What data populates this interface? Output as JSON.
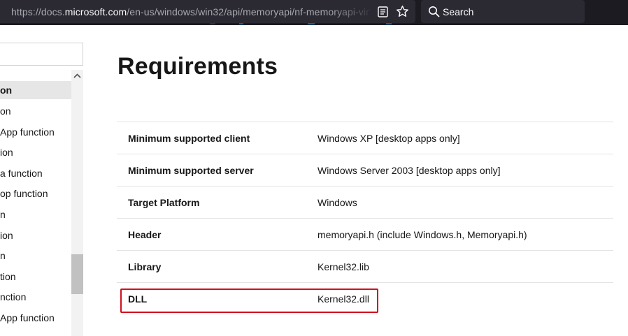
{
  "browser": {
    "url_prefix": "https://docs.",
    "url_host": "microsoft.com",
    "url_path": "/en-us/windows/win32/api/memoryapi/nf-memoryapi-vir",
    "search_placeholder": "Search",
    "icons": [
      "reader-view-icon",
      "bookmark-star-icon",
      "search-icon"
    ]
  },
  "sidebar": {
    "items": [
      {
        "label": "on",
        "selected": true
      },
      {
        "label": "on",
        "selected": false
      },
      {
        "label": "App function",
        "selected": false
      },
      {
        "label": "ion",
        "selected": false
      },
      {
        "label": "a function",
        "selected": false
      },
      {
        "label": "op function",
        "selected": false
      },
      {
        "label": "n",
        "selected": false
      },
      {
        "label": "ion",
        "selected": false
      },
      {
        "label": "n",
        "selected": false
      },
      {
        "label": "tion",
        "selected": false
      },
      {
        "label": "nction",
        "selected": false
      },
      {
        "label": "App function",
        "selected": false
      }
    ]
  },
  "main": {
    "title": "Requirements",
    "requirements": [
      {
        "key": "Minimum supported client",
        "value": "Windows XP [desktop apps only]"
      },
      {
        "key": "Minimum supported server",
        "value": "Windows Server 2003 [desktop apps only]"
      },
      {
        "key": "Target Platform",
        "value": "Windows"
      },
      {
        "key": "Header",
        "value": "memoryapi.h (include Windows.h, Memoryapi.h)"
      },
      {
        "key": "Library",
        "value": "Kernel32.lib"
      },
      {
        "key": "DLL",
        "value": "Kernel32.dll"
      }
    ]
  },
  "colors": {
    "toolbar_bg": "#1c1b22",
    "urlbar_bg": "#2b2a33",
    "highlight": "#d0101e",
    "selected_nav_bg": "#e6e6e6"
  }
}
